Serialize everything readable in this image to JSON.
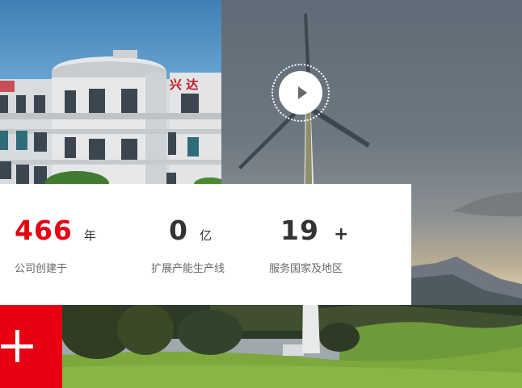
{
  "video": {
    "play_icon": "play-icon"
  },
  "stats": [
    {
      "number": "466",
      "unit": "年",
      "label": "公司创建于",
      "number_color": "#e60012"
    },
    {
      "number": "0",
      "unit": "亿",
      "label": "扩展产能生产线",
      "number_color": "#333333"
    },
    {
      "number": "19",
      "unit": "+",
      "label": "服务国家及地区",
      "number_color": "#333333"
    }
  ],
  "building_sign": "兴 达",
  "expand_button": {
    "icon": "plus-icon",
    "color": "#e60012"
  }
}
